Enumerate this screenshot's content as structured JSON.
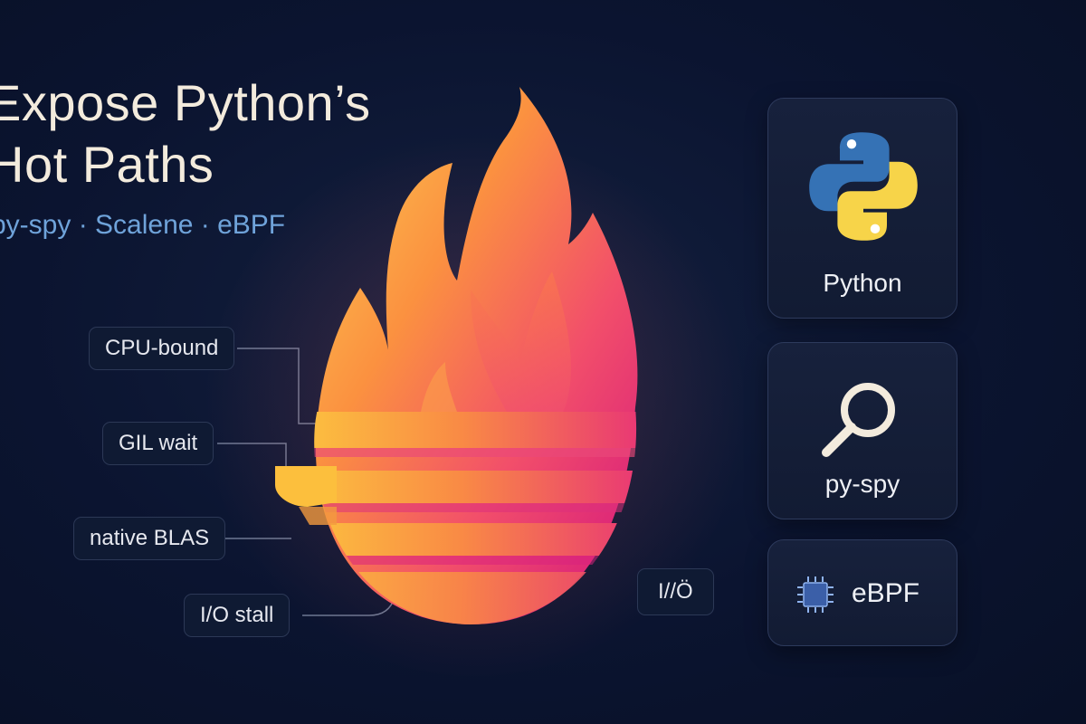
{
  "headline": {
    "line1": "Expose Python’s",
    "line2": "Hot Paths"
  },
  "subtitle": "py-spy · Scalene · eBPF",
  "flame": {
    "colors": {
      "yellow": "#fbbf3b",
      "orange": "#fb7a3c",
      "pink": "#ec3a7a",
      "magenta": "#d3157f"
    }
  },
  "tags": {
    "cpu_bound": "CPU-bound",
    "gil_wait": "GIL wait",
    "native_blas": "native BLAS",
    "io_stall": "I/O stall",
    "io_short": "I//Ö"
  },
  "cards": {
    "python": {
      "label": "Python",
      "icon": "python-logo-icon"
    },
    "pyspy": {
      "label": "py-spy",
      "icon": "magnifier-icon"
    },
    "ebpf": {
      "label": "eBPF",
      "icon": "chip-icon"
    }
  },
  "colors": {
    "background": "#0b1430",
    "text": "#f3ebdd",
    "accent_blue": "#6fa3da",
    "python_blue": "#3572b5",
    "python_yellow": "#f7d449"
  }
}
